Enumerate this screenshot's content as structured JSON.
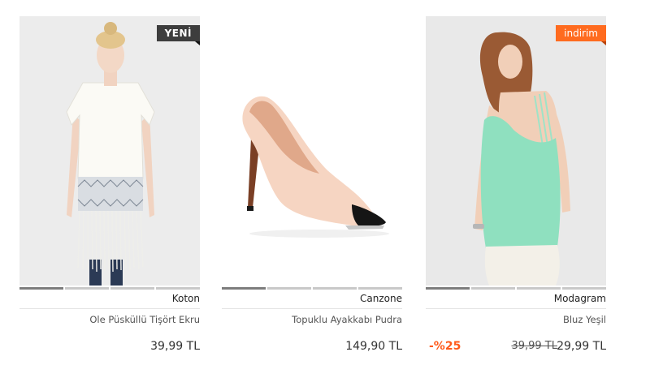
{
  "products": [
    {
      "badge": "YENİ",
      "brand": "Koton",
      "name": "Ole Püsküllü Tişört Ekru",
      "price": "39,99 TL"
    },
    {
      "brand": "Canzone",
      "name": "Topuklu Ayakkabı Pudra",
      "price": "149,90 TL"
    },
    {
      "badge": "indirim",
      "brand": "Modagram",
      "name": "Bluz Yeşil",
      "discount": "-%25",
      "old_price": "39,99 TL",
      "price": "29,99 TL"
    }
  ],
  "colors": {
    "badge_new": "#3d3d3d",
    "badge_sale": "#ff6b1f",
    "discount": "#ff5a1a"
  }
}
